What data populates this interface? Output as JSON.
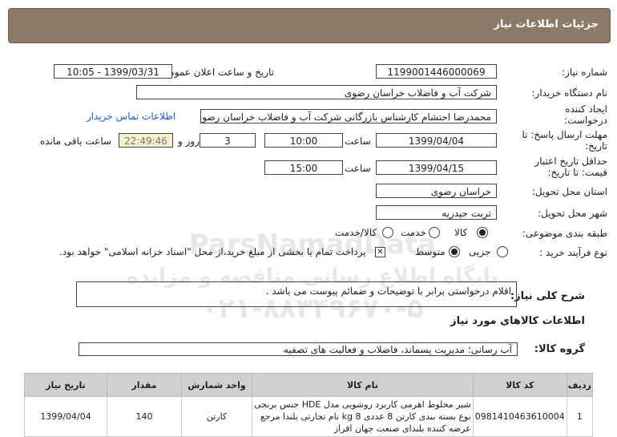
{
  "header": {
    "title": "جزئیات اطلاعات نیاز"
  },
  "fields": {
    "need_number_label": "شماره نیاز:",
    "need_number": "1199001446000069",
    "announce_label": "تاریخ و ساعت اعلان عمومی:",
    "announce_value": "1399/03/31 - 10:05",
    "buyer_label": "نام دستگاه خریدار:",
    "buyer_value": "شرکت آب و فاضلاب خراسان رضوی",
    "creator_label": "ایجاد کننده درخواست:",
    "creator_value": "محمدرضا احتشام کارشناس بازرگانی شرکت آب و فاضلاب خراسان رضوی",
    "contact_link": "اطلاعات تماس خریدار",
    "reply_label": "مهلت ارسال پاسخ: تا تاریخ:",
    "reply_date": "1399/04/04",
    "time_label": "ساعت",
    "reply_time": "10:00",
    "days_value": "3",
    "days_label": "روز و",
    "remaining_time": "22:49:46",
    "remaining_label": "ساعت باقی مانده",
    "validity_label": "حداقل تاریخ اعتبار قیمت: تا تاریخ:",
    "validity_date": "1399/04/15",
    "validity_time": "15:00",
    "province_label": "استان محل تحویل:",
    "province_value": "خراسان رضوی",
    "city_label": "شهر محل تحویل:",
    "city_value": "تربت حیدریه",
    "category_label": "طبقه بندی موضوعی:",
    "cat_goods": "کالا",
    "cat_service": "خدمت",
    "cat_both": "کالا/خدمت",
    "process_label": "نوع فرآیند خرید :",
    "proc_partial": "جزیی",
    "proc_medium": "متوسط",
    "payment_note": "پرداخت تمام یا بخشی از مبلغ خرید،از محل \"اسناد خزانه اسلامی\" خواهد بود."
  },
  "description": {
    "label": "شرح کلی نیاز:",
    "text": "اقلام درخواستی برابر با توضیحات و ضمائم پیوست می باشد ."
  },
  "goods_section": {
    "title": "اطلاعات کالاهای مورد نیاز"
  },
  "group": {
    "label": "گروه کالا:",
    "value": "آب رسانی؛ مدیریت پسماند، فاضلاب و فعالیت های تصفیه"
  },
  "watermark": {
    "line1": "ParsNamadData",
    "line2": "پایگاه اطلاع رسانی مناقصه و مزایده",
    "line3": "۰۲۱-۸۸۳۴۹۶۷۰-۵"
  },
  "table": {
    "headers": [
      "ردیف",
      "کد کالا",
      "نام کالا",
      "واحد شمارش",
      "مقدار",
      "تاریخ نیاز"
    ],
    "rows": [
      [
        "1",
        "0981410463610004",
        "شیر مخلوط اهرمی کاربرد روشویی مدل HDE جنس برنجی نوع بسته بندی کارتن 8 عددی 8 kg نام تجارتی بلندا مرجع عرضه کننده بلندای صنعت جهان افراز",
        "کارتن",
        "140",
        "1399/04/04"
      ]
    ]
  }
}
